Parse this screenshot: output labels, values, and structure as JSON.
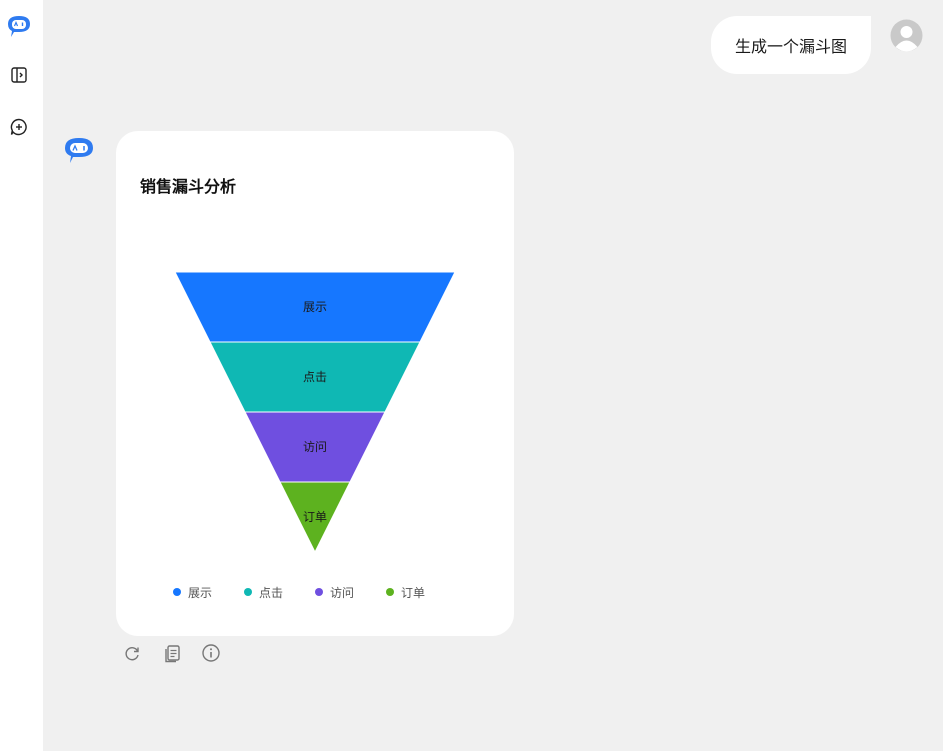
{
  "conversation": {
    "user_message": "生成一个漏斗图"
  },
  "colors": {
    "accent": "#1677ff",
    "background": "#f0f0f0",
    "bubble": "#ffffff"
  },
  "icons": {
    "sidebar": [
      "app-logo-icon",
      "toggle-sidebar-icon",
      "new-chat-icon"
    ],
    "actions": [
      "regenerate-icon",
      "copy-icon",
      "info-icon"
    ]
  },
  "chart_data": {
    "type": "funnel",
    "title": "销售漏斗分析",
    "categories": [
      "展示",
      "点击",
      "访问",
      "订单"
    ],
    "values": [
      100,
      75,
      50,
      25
    ],
    "colors": [
      "#1677ff",
      "#0fb8b4",
      "#6f4fe0",
      "#5db21f"
    ],
    "legend": "bottom",
    "sort": "descending"
  }
}
